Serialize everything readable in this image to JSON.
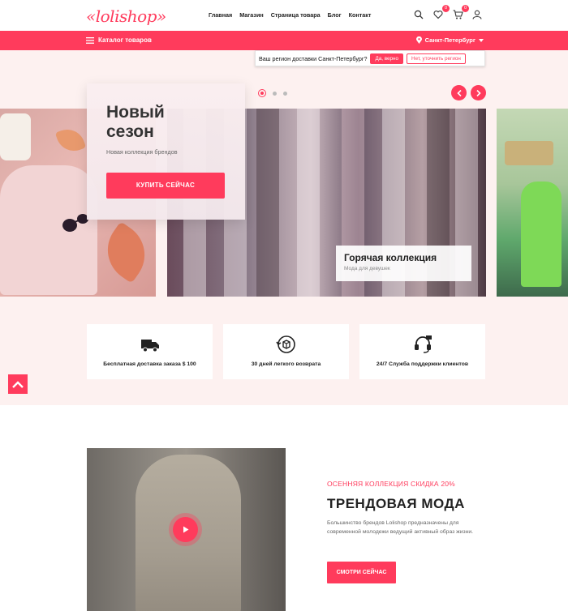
{
  "header": {
    "logo": "«lolishop»",
    "nav": [
      "Главная",
      "Магазин",
      "Страница товара",
      "Блог",
      "Контакт"
    ],
    "wishlist_count": "0",
    "cart_count": "0"
  },
  "catbar": {
    "catalog_label": "Каталог товаров",
    "city": "Санкт-Петербург"
  },
  "region_popup": {
    "question": "Ваш регион доставки Санкт-Петербург?",
    "yes_label": "Да, верно",
    "no_label": "Нет, уточнить регион"
  },
  "hero": {
    "title": "Новый сезон",
    "subtitle": "Новая коллекция брендов",
    "button": "КУПИТЬ СЕЙЧАС",
    "caption_title": "Горячая коллекция",
    "caption_sub": "Мода для девушек"
  },
  "features": [
    {
      "label": "Бесплатная доставка заказа $ 100",
      "icon": "truck-icon"
    },
    {
      "label": "30 дней легкого возврата",
      "icon": "return-box-icon"
    },
    {
      "label": "24/7 Служба поддержки клиентов",
      "icon": "headset-icon"
    }
  ],
  "trend": {
    "subtitle": "ОСЕННЯЯ КОЛЛЕКЦИЯ СКИДКА 20%",
    "title": "ТРЕНДОВАЯ МОДА",
    "description": "Большинство брендов Lolishop предназначены для современной молодежи ведущий активный образ жизни.",
    "button": "СМОТРИ СЕЙЧАС"
  },
  "colors": {
    "accent": "#ff3b5c",
    "hero_bg": "#fdf1f0"
  }
}
